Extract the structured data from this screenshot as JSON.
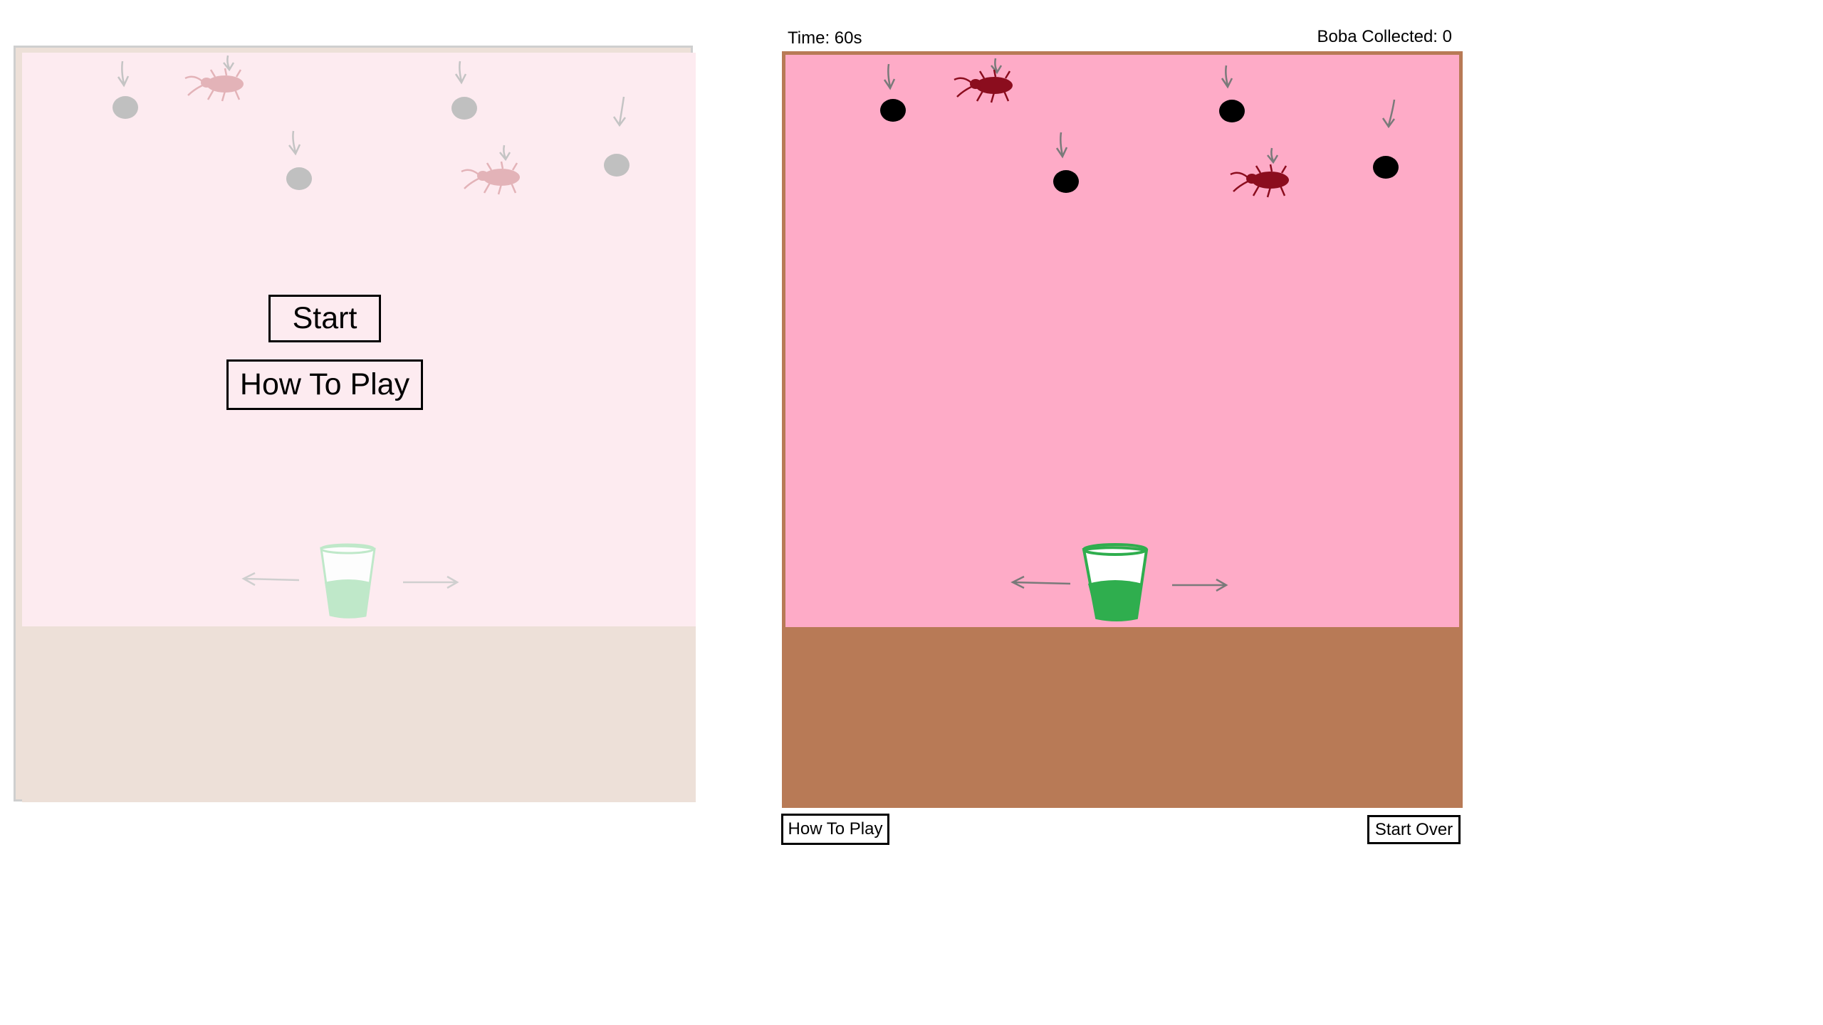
{
  "start_screen": {
    "start_label": "Start",
    "how_to_play_label": "How To Play"
  },
  "game_screen": {
    "time_text": "Time: 60s",
    "boba_collected_text": "Boba Collected: 0",
    "how_to_play_label": "How To Play",
    "start_over_label": "Start Over"
  },
  "icons": {
    "boba_pearl": "boba-pearl-icon",
    "cockroach": "cockroach-icon",
    "cup": "boba-cup-icon",
    "arrow_left": "arrow-left-icon",
    "arrow_right": "arrow-right-icon",
    "arrow_down": "arrow-down-icon"
  },
  "colors": {
    "start_sky": "#fdebf0",
    "start_ground": "#ede0d8",
    "game_sky": "#feabc7",
    "game_ground": "#b87a56",
    "pearl": "#000000",
    "pearl_faded": "#c0c0c0",
    "cockroach": "#8b0d1e",
    "cockroach_faded": "#e3b3b8",
    "cup_green": "#2fae4e"
  }
}
